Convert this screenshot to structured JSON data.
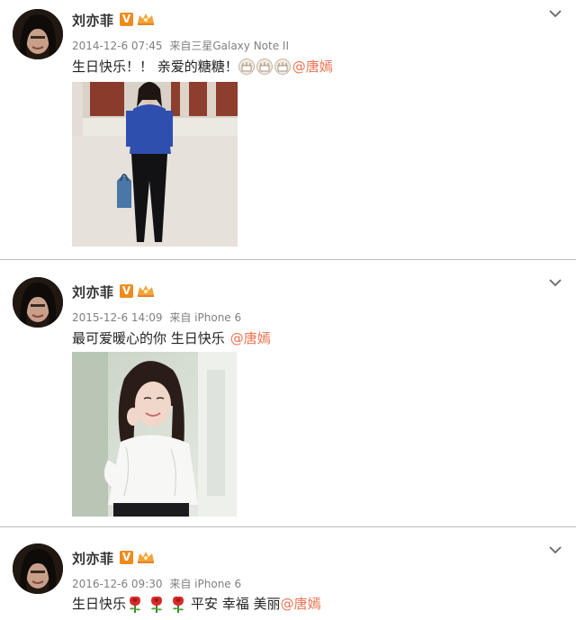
{
  "colors": {
    "mention": "#eb7350",
    "v_badge": "#ef8b1d",
    "meta_text": "#808080",
    "divider": "#bdbdbd"
  },
  "posts": [
    {
      "username": "刘亦菲",
      "verified_badge": "V",
      "level_icon": "crown-level-icon",
      "timestamp": "2014-12-6 07:45",
      "source_prefix": "来自",
      "source": "三星Galaxy Note II",
      "text": "生日快乐！！ 亲爱的糖糖！",
      "emoji": [
        "cake-icon",
        "cake-icon",
        "cake-icon"
      ],
      "mention": "@唐嫣",
      "photo_icon": "photo-woman-blue-top"
    },
    {
      "username": "刘亦菲",
      "verified_badge": "V",
      "level_icon": "crown-level-icon",
      "timestamp": "2015-12-6 14:09",
      "source_prefix": "来自",
      "source": "iPhone 6",
      "text": "最可爱暖心的你 生日快乐",
      "mention": "@唐嫣",
      "photo_icon": "photo-woman-white-dress"
    },
    {
      "username": "刘亦菲",
      "verified_badge": "V",
      "level_icon": "crown-level-icon",
      "timestamp": "2016-12-6 09:30",
      "source_prefix": "来自",
      "source": "iPhone 6",
      "text_before": "生日快乐",
      "emoji": [
        "rose-icon",
        "rose-icon",
        "rose-icon"
      ],
      "text_after": "平安 幸福 美丽",
      "mention": "@唐嫣"
    }
  ]
}
